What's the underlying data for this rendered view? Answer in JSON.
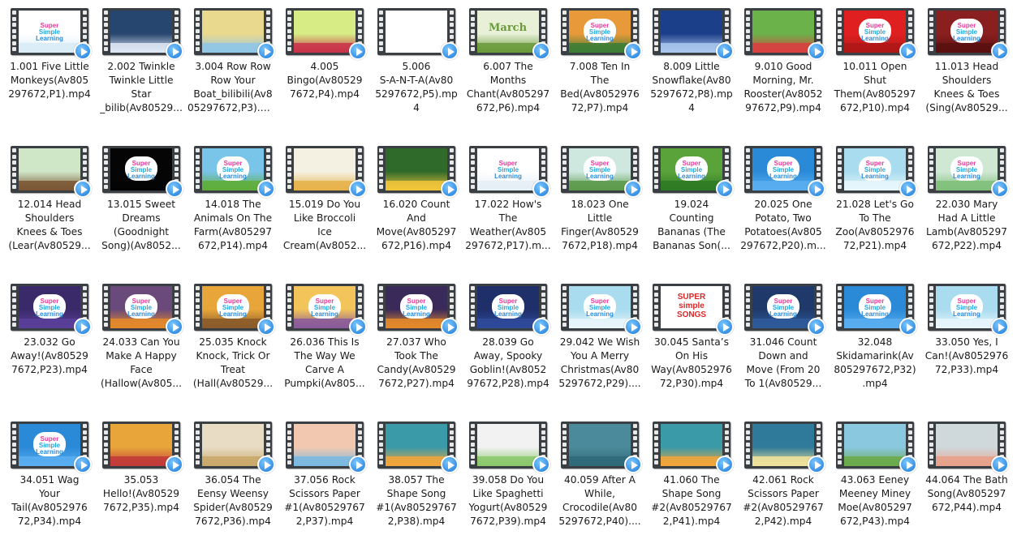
{
  "files": [
    {
      "name": "1.001 Five Little Monkeys(Av805297672,P1).mp4",
      "lines": [
        "1.001 Five Little",
        "Monkeys(Av805",
        "297672,P1).mp4"
      ],
      "thumb": {
        "bg": "#ffffff",
        "accent": "#d8ecf7",
        "logo": true
      }
    },
    {
      "name": "2.002 Twinkle Twinkle Little Star _bilib",
      "lines": [
        "2.002 Twinkle",
        "Twinkle Little",
        "Star",
        "_bilib(Av80529..."
      ],
      "thumb": {
        "bg": "#27466f",
        "accent": "#dfe8f5",
        "logo": false
      }
    },
    {
      "name": "3.004 Row Row Row Your Boat_bilibili(Av805297672,P3).mp4",
      "lines": [
        "3.004 Row Row",
        "Row Your",
        "Boat_bilibili(Av8",
        "05297672,P3).mp4"
      ],
      "thumb": {
        "bg": "#e9d98e",
        "accent": "#8fc6e6",
        "logo": false
      }
    },
    {
      "name": "4.005 Bingo(Av805297672,P4).mp4",
      "lines": [
        "4.005",
        "Bingo(Av80529",
        "7672,P4).mp4"
      ],
      "thumb": {
        "bg": "#d7ec85",
        "accent": "#c9324a",
        "logo": false
      }
    },
    {
      "name": "5.006 S-A-N-T-A(Av805297672,P5).mp4",
      "lines": [
        "5.006",
        "S-A-N-T-A(Av80",
        "5297672,P5).mp",
        "4"
      ],
      "thumb": {
        "bg": "#ffffff",
        "accent": "#ffffff",
        "logo": false
      }
    },
    {
      "name": "6.007 The Months Chant(Av805297672,P6).mp4",
      "lines": [
        "6.007 The",
        "Months",
        "Chant(Av805297",
        "672,P6).mp4"
      ],
      "thumb": {
        "bg": "#e8f1d8",
        "accent": "#6a9a3a",
        "logo": false
      }
    },
    {
      "name": "7.008 Ten In The Bed(Av805297672,P7).mp4",
      "lines": [
        "7.008 Ten In",
        "The",
        "Bed(Av8052976",
        "72,P7).mp4"
      ],
      "thumb": {
        "bg": "#e89a3a",
        "accent": "#3c7c35",
        "logo": true
      }
    },
    {
      "name": "8.009 Little Snowflake(Av805297672,P8).mp4",
      "lines": [
        "8.009 Little",
        "Snowflake(Av80",
        "5297672,P8).mp",
        "4"
      ],
      "thumb": {
        "bg": "#1c3f8a",
        "accent": "#a9c8ee",
        "logo": false
      }
    },
    {
      "name": "9.010 Good Morning, Mr. Rooster(Av805297672,P9).mp4",
      "lines": [
        "9.010 Good",
        "Morning, Mr.",
        "Rooster(Av8052",
        "97672,P9).mp4"
      ],
      "thumb": {
        "bg": "#6bb24a",
        "accent": "#d94040",
        "logo": false
      }
    },
    {
      "name": "10.011 Open Shut Them(Av805297672,P10).mp4",
      "lines": [
        "10.011 Open",
        "Shut",
        "Them(Av805297",
        "672,P10).mp4"
      ],
      "thumb": {
        "bg": "#e02020",
        "accent": "#b01818",
        "logo": true
      }
    },
    {
      "name": "11.013 Head Shoulders Knees & Toes (Sing",
      "lines": [
        "11.013 Head",
        "Shoulders",
        "Knees & Toes",
        "(Sing(Av80529..."
      ],
      "thumb": {
        "bg": "#8a1f1f",
        "accent": "#5a1010",
        "logo": true
      }
    },
    {
      "name": "12.014 Head Shoulders Knees & Toes (Lear",
      "lines": [
        "12.014 Head",
        "Shoulders",
        "Knees & Toes",
        "(Lear(Av80529..."
      ],
      "thumb": {
        "bg": "#cfe6c7",
        "accent": "#7a5634",
        "logo": false
      }
    },
    {
      "name": "13.015 Sweet Dreams (Goodnight Song)",
      "lines": [
        "13.015 Sweet",
        "Dreams",
        "(Goodnight",
        "Song)(Av8052..."
      ],
      "thumb": {
        "bg": "#050505",
        "accent": "#050505",
        "logo": true
      }
    },
    {
      "name": "14.018 The Animals On The Farm(Av805297672,P14).mp4",
      "lines": [
        "14.018 The",
        "Animals On The",
        "Farm(Av805297",
        "672,P14).mp4"
      ],
      "thumb": {
        "bg": "#79c4e9",
        "accent": "#5fae3a",
        "logo": true
      }
    },
    {
      "name": "15.019 Do You Like Broccoli Ice Cream",
      "lines": [
        "15.019 Do You",
        "Like Broccoli",
        "Ice",
        "Cream(Av8052..."
      ],
      "thumb": {
        "bg": "#f4f1e2",
        "accent": "#e6b24a",
        "logo": false
      }
    },
    {
      "name": "16.020 Count And Move(Av805297672,P16).mp4",
      "lines": [
        "16.020 Count",
        "And",
        "Move(Av805297",
        "672,P16).mp4"
      ],
      "thumb": {
        "bg": "#2f6a2a",
        "accent": "#f2c53a",
        "logo": false
      }
    },
    {
      "name": "17.022 How's The Weather(Av805297672,P17).mp4",
      "lines": [
        "17.022 How's",
        "The",
        "Weather(Av805",
        "297672,P17).m..."
      ],
      "thumb": {
        "bg": "#ffffff",
        "accent": "#e5eef6",
        "logo": true
      }
    },
    {
      "name": "18.023 One Little Finger(Av805297672,P18).mp4",
      "lines": [
        "18.023 One",
        "Little",
        "Finger(Av80529",
        "7672,P18).mp4"
      ],
      "thumb": {
        "bg": "#cfe8df",
        "accent": "#5a9a4a",
        "logo": true
      }
    },
    {
      "name": "19.024 Counting Bananas (The Bananas Son",
      "lines": [
        "19.024",
        "Counting",
        "Bananas (The",
        "Bananas Son(..."
      ],
      "thumb": {
        "bg": "#5aa33a",
        "accent": "#2f7a25",
        "logo": true
      }
    },
    {
      "name": "20.025 One Potato, Two Potatoes(Av805297672,P20).mp4",
      "lines": [
        "20.025 One",
        "Potato, Two",
        "Potatoes(Av805",
        "297672,P20).m..."
      ],
      "thumb": {
        "bg": "#2b8ad8",
        "accent": "#59aef0",
        "logo": true
      }
    },
    {
      "name": "21.028 Let's Go To The Zoo(Av805297672,P21).mp4",
      "lines": [
        "21.028 Let's Go",
        "To The",
        "Zoo(Av8052976",
        "72,P21).mp4"
      ],
      "thumb": {
        "bg": "#a9dcef",
        "accent": "#e8f6fb",
        "logo": true
      }
    },
    {
      "name": "22.030 Mary Had A Little Lamb(Av805297672,P22).mp4",
      "lines": [
        "22.030 Mary",
        "Had A Little",
        "Lamb(Av805297",
        "672,P22).mp4"
      ],
      "thumb": {
        "bg": "#cfe8d4",
        "accent": "#7fbf7a",
        "logo": true
      }
    },
    {
      "name": "23.032 Go Away!(Av805297672,P23).mp4",
      "lines": [
        "23.032 Go",
        "Away!(Av80529",
        "7672,P23).mp4"
      ],
      "thumb": {
        "bg": "#3a2a6a",
        "accent": "#5b3f9a",
        "logo": true
      }
    },
    {
      "name": "24.033 Can You Make A Happy Face (Hallow",
      "lines": [
        "24.033 Can You",
        "Make A Happy",
        "Face",
        "(Hallow(Av805..."
      ],
      "thumb": {
        "bg": "#6a4a7a",
        "accent": "#e58a2a",
        "logo": true
      }
    },
    {
      "name": "25.035 Knock Knock, Trick Or Treat (Hall",
      "lines": [
        "25.035 Knock",
        "Knock, Trick Or",
        "Treat",
        "(Hall(Av80529..."
      ],
      "thumb": {
        "bg": "#e8a63a",
        "accent": "#8a5a2a",
        "logo": true
      }
    },
    {
      "name": "26.036 This Is The Way We Carve A Pumpki",
      "lines": [
        "26.036 This Is",
        "The Way We",
        "Carve A",
        "Pumpki(Av805..."
      ],
      "thumb": {
        "bg": "#f2c45a",
        "accent": "#8a5a9a",
        "logo": true
      }
    },
    {
      "name": "27.037 Who Took The Candy(Av805297672,P27).mp4",
      "lines": [
        "27.037 Who",
        "Took The",
        "Candy(Av80529",
        "7672,P27).mp4"
      ],
      "thumb": {
        "bg": "#3a2a5a",
        "accent": "#e58a2a",
        "logo": true
      }
    },
    {
      "name": "28.039 Go Away, Spooky Goblin!(Av805297672,P28).mp4",
      "lines": [
        "28.039 Go",
        "Away, Spooky",
        "Goblin!(Av8052",
        "97672,P28).mp4"
      ],
      "thumb": {
        "bg": "#1f2f6a",
        "accent": "#2f4a9a",
        "logo": true
      }
    },
    {
      "name": "29.042 We Wish You A Merry Christmas(Av805297672,P29)",
      "lines": [
        "29.042 We Wish",
        "You A Merry",
        "Christmas(Av80",
        "5297672,P29)...."
      ],
      "thumb": {
        "bg": "#a9dcef",
        "accent": "#e8f6fb",
        "logo": true
      }
    },
    {
      "name": "30.045 Santa's On His Way(Av805297672,P30).mp4",
      "lines": [
        "30.045 Santa’s",
        "On His",
        "Way(Av8052976",
        "72,P30).mp4"
      ],
      "thumb": {
        "bg": "#ffffff",
        "accent": "#ffffff",
        "logo": false
      }
    },
    {
      "name": "31.046 Count Down and Move (From 20 To 1",
      "lines": [
        "31.046 Count",
        "Down and",
        "Move (From 20",
        "To 1(Av80529..."
      ],
      "thumb": {
        "bg": "#1f3a6a",
        "accent": "#2f5a9a",
        "logo": true
      }
    },
    {
      "name": "32.048 Skidamarink(Av805297672,P32).mp4",
      "lines": [
        "32.048",
        "Skidamarink(Av",
        "805297672,P32)",
        ".mp4"
      ],
      "thumb": {
        "bg": "#2b8ad8",
        "accent": "#59aef0",
        "logo": true
      }
    },
    {
      "name": "33.050 Yes, I Can!(Av805297672,P33).mp4",
      "lines": [
        "33.050 Yes, I",
        "Can!(Av8052976",
        "72,P33).mp4"
      ],
      "thumb": {
        "bg": "#a9dcef",
        "accent": "#e8f6fb",
        "logo": true
      }
    },
    {
      "name": "34.051 Wag Your Tail(Av805297672,P34).mp4",
      "lines": [
        "34.051 Wag",
        "Your",
        "Tail(Av8052976",
        "72,P34).mp4"
      ],
      "thumb": {
        "bg": "#2b8ad8",
        "accent": "#59aef0",
        "logo": true
      }
    },
    {
      "name": "35.053 Hello!(Av805297672,P35).mp4",
      "lines": [
        "35.053",
        "Hello!(Av80529",
        "7672,P35).mp4"
      ],
      "thumb": {
        "bg": "#e8a63a",
        "accent": "#c23a3a",
        "logo": false
      }
    },
    {
      "name": "36.054 The Eensy Weensy Spider(Av805297672,P36).mp4",
      "lines": [
        "36.054 The",
        "Eensy Weensy",
        "Spider(Av80529",
        "7672,P36).mp4"
      ],
      "thumb": {
        "bg": "#e8dcc4",
        "accent": "#c9a86a",
        "logo": false
      }
    },
    {
      "name": "37.056 Rock Scissors Paper #1(Av805297672,P37).mp4",
      "lines": [
        "37.056 Rock",
        "Scissors Paper",
        "#1(Av80529767",
        "2,P37).mp4"
      ],
      "thumb": {
        "bg": "#f2c9b0",
        "accent": "#7ab8e0",
        "logo": false
      }
    },
    {
      "name": "38.057 The Shape Song #1(Av805297672,P38).mp4",
      "lines": [
        "38.057 The",
        "Shape Song",
        "#1(Av80529767",
        "2,P38).mp4"
      ],
      "thumb": {
        "bg": "#3a9aa8",
        "accent": "#f2a63a",
        "logo": false
      }
    },
    {
      "name": "39.058 Do You Like Spaghetti Yogurt(Av805297672,P39).mp4",
      "lines": [
        "39.058 Do You",
        "Like Spaghetti",
        "Yogurt(Av80529",
        "7672,P39).mp4"
      ],
      "thumb": {
        "bg": "#f2f2f2",
        "accent": "#8ac86a",
        "logo": false
      }
    },
    {
      "name": "40.059 After A While, Crocodile(Av805297672,P40).mp4",
      "lines": [
        "40.059 After A",
        "While,",
        "Crocodile(Av80",
        "5297672,P40)...."
      ],
      "thumb": {
        "bg": "#4a8a9a",
        "accent": "#2f6a7a",
        "logo": false
      }
    },
    {
      "name": "41.060 The Shape Song #2(Av805297672,P41).mp4",
      "lines": [
        "41.060 The",
        "Shape Song",
        "#2(Av80529767",
        "2,P41).mp4"
      ],
      "thumb": {
        "bg": "#3a9aa8",
        "accent": "#f2a63a",
        "logo": false
      }
    },
    {
      "name": "42.061 Rock Scissors Paper #2(Av805297672,P42).mp4",
      "lines": [
        "42.061 Rock",
        "Scissors Paper",
        "#2(Av80529767",
        "2,P42).mp4"
      ],
      "thumb": {
        "bg": "#2f7a9a",
        "accent": "#f2e29a",
        "logo": false
      }
    },
    {
      "name": "43.063 Eeney Meeney Miney Moe(Av805297672,P43).mp4",
      "lines": [
        "43.063 Eeney",
        "Meeney Miney",
        "Moe(Av805297",
        "672,P43).mp4"
      ],
      "thumb": {
        "bg": "#8ac8e0",
        "accent": "#6aaa4a",
        "logo": false
      }
    },
    {
      "name": "44.064 The Bath Song(Av805297672,P44).mp4",
      "lines": [
        "44.064 The Bath",
        "Song(Av805297",
        "672,P44).mp4"
      ],
      "thumb": {
        "bg": "#cfd9dc",
        "accent": "#e8a08a",
        "logo": false
      }
    }
  ],
  "logo_text": {
    "line1": "Super",
    "line2": "Simple",
    "line3": "Learning"
  },
  "special_text": {
    "march": "March",
    "super_simple_songs": "SUPER simple SONGS"
  },
  "icons": {
    "play_overlay": "play-icon",
    "film_strip": "film-strip-icon"
  },
  "colors": {
    "play_blue": "#1a78d8",
    "film_dark": "#3a3f44",
    "label_text": "#1a1a1a"
  }
}
